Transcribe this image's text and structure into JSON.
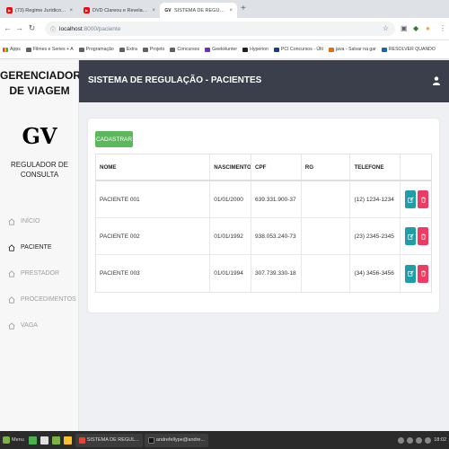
{
  "browser": {
    "tabs": [
      {
        "title": "(73) Regime Jurídico dos Servido",
        "favicon": "youtube-icon"
      },
      {
        "title": "DVD Clareou e Revelação - Roda",
        "favicon": "youtube-icon"
      },
      {
        "title": "SISTEMA DE REGULAÇÃO",
        "favicon": "gv-icon",
        "favicon_text": "GV"
      }
    ],
    "url_host": "localhost",
    "url_path": ":8000/paciente",
    "bookmarks": [
      {
        "label": "Apps",
        "icon": "apps-icon"
      },
      {
        "label": "Filmes e Series + A",
        "icon": "folder-icon"
      },
      {
        "label": "Programação",
        "icon": "folder-icon"
      },
      {
        "label": "Extra",
        "icon": "folder-icon"
      },
      {
        "label": "Projeto",
        "icon": "folder-icon"
      },
      {
        "label": "Concursos",
        "icon": "folder-icon"
      },
      {
        "label": "GeekHunter",
        "icon": "geekhunter-icon"
      },
      {
        "label": "Hyperion",
        "icon": "hyperion-icon"
      },
      {
        "label": "PCI Concursos - Últi",
        "icon": "pci-icon"
      },
      {
        "label": "java - Salvar na gar",
        "icon": "java-icon"
      },
      {
        "label": "RESOLVER QUANDO",
        "icon": "resolver-icon"
      }
    ]
  },
  "sidebar": {
    "brand_line1": "GERENCIADOR",
    "brand_line2": "DE VIAGEM",
    "logo": "GV",
    "subtitle": "REGULADOR DE CONSULTA",
    "items": [
      {
        "label": "INÍCIO",
        "icon": "home-icon",
        "active": false
      },
      {
        "label": "PACIENTE",
        "icon": "home-icon",
        "active": true
      },
      {
        "label": "PRESTADOR",
        "icon": "home-icon",
        "active": false
      },
      {
        "label": "PROCEDIMENTOS",
        "icon": "home-icon",
        "active": false
      },
      {
        "label": "VAGA",
        "icon": "home-icon",
        "active": false
      }
    ]
  },
  "header": {
    "title": "SISTEMA DE REGULAÇÃO - PACIENTES",
    "user_icon": "user-icon"
  },
  "main": {
    "cadastrar_label": "CADASTRAR",
    "columns": [
      "NOME",
      "NASCIMENTO",
      "CPF",
      "RG",
      "TELEFONE",
      ""
    ],
    "rows": [
      {
        "nome": "PACIENTE 001",
        "nascimento": "01/01/2000",
        "cpf": "639.331.900-37",
        "rg": "",
        "telefone": "(12) 1234-1234"
      },
      {
        "nome": "PACIENTE 002",
        "nascimento": "01/01/1992",
        "cpf": "938.053.240-73",
        "rg": "",
        "telefone": "(23) 2345-2345"
      },
      {
        "nome": "PACIENTE 003",
        "nascimento": "01/01/1994",
        "cpf": "307.739.330-18",
        "rg": "",
        "telefone": "(34) 3456-3456"
      }
    ]
  },
  "taskbar": {
    "menu_label": "Menu",
    "tasks": [
      "SISTEMA DE REGUL...",
      "andrefellype@andre..."
    ],
    "clock": "18:02"
  },
  "colors": {
    "header_bg": "#3a3f4b",
    "cadastrar_green": "#5cb85c",
    "edit_teal": "#1e9ea9",
    "delete_red": "#ef3b63"
  }
}
